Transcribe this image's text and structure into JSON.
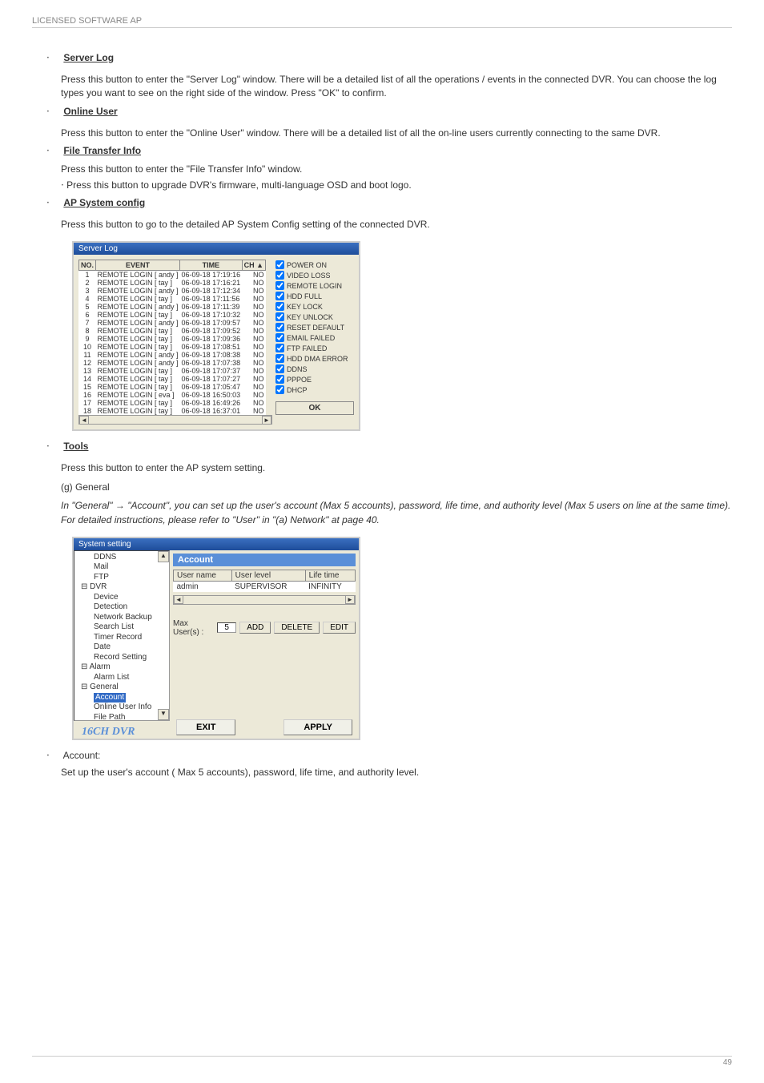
{
  "header": {
    "left": "LICENSED SOFTWARE AP",
    "right": ""
  },
  "sections": {
    "server_log": {
      "title": "Server Log",
      "text": "Press this button to enter the \"Server Log\" window. There will be a detailed list of all the operations / events in the connected DVR. You can choose the log types you want to see on the right side of the window. Press \"OK\" to confirm."
    },
    "online_user": {
      "title": "Online User",
      "text": "Press this button to enter the \"Online User\" window. There will be a detailed list of all the on-line users currently connecting to the same DVR."
    },
    "file_transfer_info": {
      "title": "File Transfer Info",
      "text": "Press this button to enter the \"File Transfer Info\" window."
    },
    "upgrade": {
      "title": "",
      "text": "Press this button to upgrade DVR's firmware, multi-language OSD and boot logo."
    },
    "ap_system_config": {
      "title": "AP System config",
      "text": "Press this button to go to the detailed AP System Config setting of the connected DVR."
    }
  },
  "server_log_window": {
    "title": "Server Log",
    "columns": [
      "NO.",
      "EVENT",
      "TIME",
      "CH"
    ],
    "rows": [
      {
        "no": "1",
        "event": "REMOTE LOGIN [ andy ]",
        "time": "06-09-18 17:19:16",
        "ch": "NO"
      },
      {
        "no": "2",
        "event": "REMOTE LOGIN [ tay ]",
        "time": "06-09-18 17:16:21",
        "ch": "NO"
      },
      {
        "no": "3",
        "event": "REMOTE LOGIN [ andy ]",
        "time": "06-09-18 17:12:34",
        "ch": "NO"
      },
      {
        "no": "4",
        "event": "REMOTE LOGIN [ tay ]",
        "time": "06-09-18 17:11:56",
        "ch": "NO"
      },
      {
        "no": "5",
        "event": "REMOTE LOGIN [ andy ]",
        "time": "06-09-18 17:11:39",
        "ch": "NO"
      },
      {
        "no": "6",
        "event": "REMOTE LOGIN [ tay ]",
        "time": "06-09-18 17:10:32",
        "ch": "NO"
      },
      {
        "no": "7",
        "event": "REMOTE LOGIN [ andy ]",
        "time": "06-09-18 17:09:57",
        "ch": "NO"
      },
      {
        "no": "8",
        "event": "REMOTE LOGIN [ tay ]",
        "time": "06-09-18 17:09:52",
        "ch": "NO"
      },
      {
        "no": "9",
        "event": "REMOTE LOGIN [ tay ]",
        "time": "06-09-18 17:09:36",
        "ch": "NO"
      },
      {
        "no": "10",
        "event": "REMOTE LOGIN [ tay ]",
        "time": "06-09-18 17:08:51",
        "ch": "NO"
      },
      {
        "no": "11",
        "event": "REMOTE LOGIN [ andy ]",
        "time": "06-09-18 17:08:38",
        "ch": "NO"
      },
      {
        "no": "12",
        "event": "REMOTE LOGIN [ andy ]",
        "time": "06-09-18 17:07:38",
        "ch": "NO"
      },
      {
        "no": "13",
        "event": "REMOTE LOGIN [ tay ]",
        "time": "06-09-18 17:07:37",
        "ch": "NO"
      },
      {
        "no": "14",
        "event": "REMOTE LOGIN [ tay ]",
        "time": "06-09-18 17:07:27",
        "ch": "NO"
      },
      {
        "no": "15",
        "event": "REMOTE LOGIN [ tay ]",
        "time": "06-09-18 17:05:47",
        "ch": "NO"
      },
      {
        "no": "16",
        "event": "REMOTE LOGIN [ eva ]",
        "time": "06-09-18 16:50:03",
        "ch": "NO"
      },
      {
        "no": "17",
        "event": "REMOTE LOGIN [ tay ]",
        "time": "06-09-18 16:49:26",
        "ch": "NO"
      },
      {
        "no": "18",
        "event": "REMOTE LOGIN [ tay ]",
        "time": "06-09-18 16:37:01",
        "ch": "NO"
      }
    ],
    "filters": [
      "POWER ON",
      "VIDEO LOSS",
      "REMOTE LOGIN",
      "HDD FULL",
      "KEY LOCK",
      "KEY UNLOCK",
      "RESET DEFAULT",
      "EMAIL FAILED",
      "FTP FAILED",
      "HDD DMA ERROR",
      "DDNS",
      "PPPOE",
      "DHCP"
    ],
    "ok": "OK"
  },
  "tools_section": {
    "title": "Tools",
    "lines": [
      "Press this button to enter the AP system setting.",
      "(g) General",
      "In \"General\" → \"Account\", you can set up the user's account (Max 5 accounts), password, life time, and authority level (Max 5 users on line at the same time). For detailed instructions, please refer to \"User\" in \"(a) Network\" at page 40."
    ]
  },
  "system_setting_window": {
    "title": "System setting",
    "tree": {
      "upper": [
        "DDNS",
        "Mail",
        "FTP"
      ],
      "dvr": [
        "Device",
        "Detection",
        "Network Backup",
        "Search List",
        "Timer Record",
        "Date",
        "Record Setting"
      ],
      "alarm": [
        "Alarm List"
      ],
      "general": [
        "Account",
        "Online User Info",
        "File Path"
      ],
      "dvr_label": "DVR",
      "alarm_label": "Alarm",
      "general_label": "General"
    },
    "brand": "16CH DVR",
    "section_header": "Account",
    "columns": [
      "User name",
      "User level",
      "Life time"
    ],
    "row": {
      "user": "admin",
      "level": "SUPERVISOR",
      "life": "INFINITY"
    },
    "maxuser_label": "Max User(s) :",
    "maxuser_value": "5",
    "add": "ADD",
    "delete": "DELETE",
    "edit": "EDIT",
    "exit": "EXIT",
    "apply": "APPLY"
  },
  "account_section": {
    "title": "Account:",
    "text": "Set up the user's account ( Max 5 accounts), password, life time, and authority level."
  },
  "footer": {
    "left": "",
    "right": "49"
  }
}
